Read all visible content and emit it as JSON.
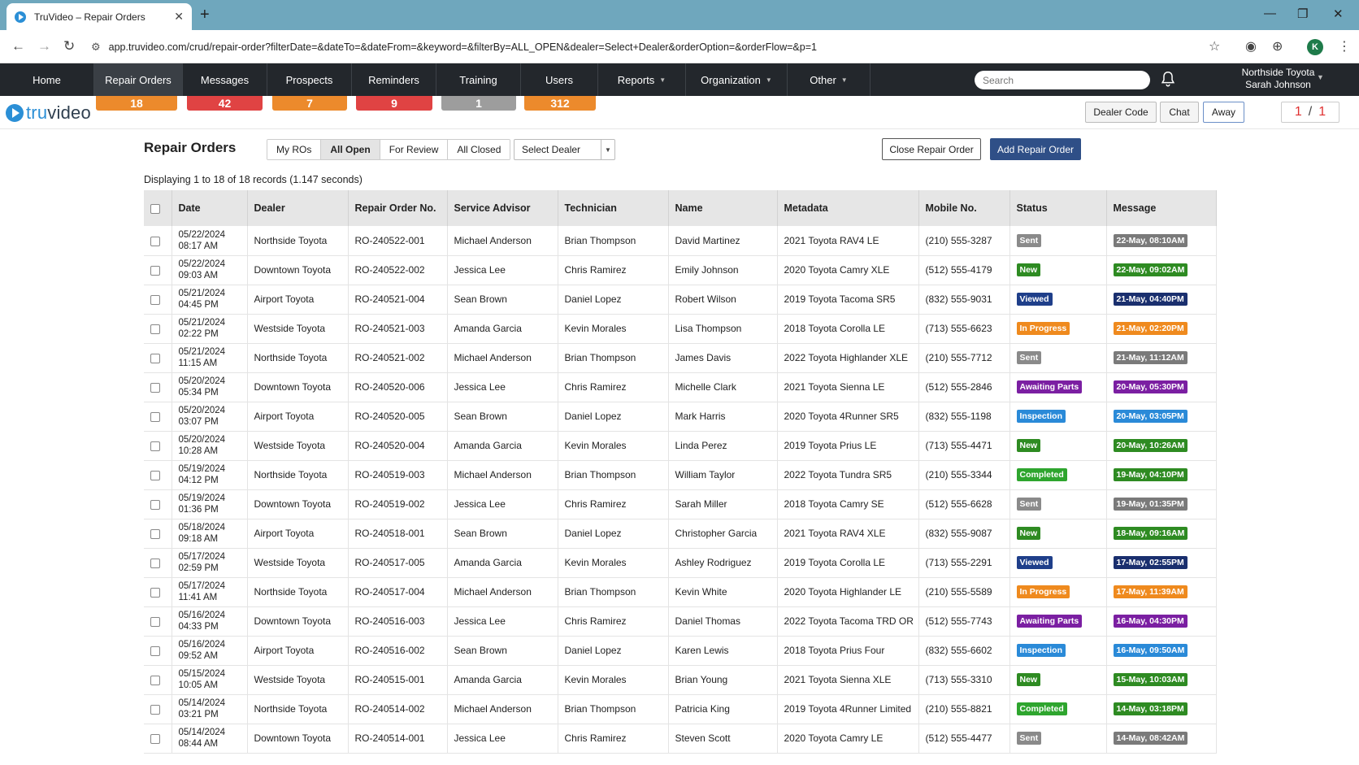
{
  "browser": {
    "tab_title": "TruVideo – Repair Orders",
    "url": "app.truvideo.com/crud/repair-order?filterDate=&dateTo=&dateFrom=&keyword=&filterBy=ALL_OPEN&dealer=Select+Dealer&orderOption=&orderFlow=&p=1",
    "profile_initial": "K"
  },
  "nav": {
    "items": [
      {
        "label": "Home",
        "caret": ""
      },
      {
        "label": "Repair Orders",
        "caret": ""
      },
      {
        "label": "Messages",
        "caret": ""
      },
      {
        "label": "Prospects",
        "caret": ""
      },
      {
        "label": "Reminders",
        "caret": ""
      },
      {
        "label": "Training",
        "caret": ""
      },
      {
        "label": "Users",
        "caret": ""
      },
      {
        "label": "Reports",
        "caret": "▼"
      },
      {
        "label": "Organization",
        "caret": "▼"
      },
      {
        "label": "Other",
        "caret": "▼"
      }
    ],
    "search_placeholder": "Search",
    "user_org": "Northside Toyota",
    "user_name": "Sarah Johnson"
  },
  "badges": [
    {
      "value": "18",
      "color": "#ec8a2c"
    },
    {
      "value": "42",
      "color": "#e04343"
    },
    {
      "value": "7",
      "color": "#ec8a2c"
    },
    {
      "value": "9",
      "color": "#e04343"
    },
    {
      "value": "1",
      "color": "#9d9d9d"
    },
    {
      "value": "312",
      "color": "#ec8a2c"
    }
  ],
  "logo": {
    "prefix": "tru",
    "suffix": "video"
  },
  "top_buttons": {
    "dealer_code": "Dealer Code",
    "chat": "Chat",
    "away": "Away"
  },
  "pager": {
    "current": "1",
    "sep": "/",
    "total": "1"
  },
  "toolbar": {
    "title": "Repair Orders",
    "filters": [
      "My ROs",
      "All Open",
      "For Review",
      "All Closed"
    ],
    "active_filter": "All Open",
    "dealer_select": "Select Dealer",
    "close_button": "Close Repair Order",
    "add_button": "Add Repair Order"
  },
  "records_text": "Displaying 1 to 18 of 18 records (1.147 seconds)",
  "table": {
    "columns": [
      "Date",
      "Dealer",
      "Repair Order No.",
      "Service Advisor",
      "Technician",
      "Name",
      "Metadata",
      "Mobile No.",
      "Status",
      "Message"
    ],
    "rows": [
      {
        "date": "05/22/2024",
        "time": "08:17 AM",
        "dealer": "Northside Toyota",
        "ro": "RO-240522-001",
        "advisor": "Michael Anderson",
        "tech": "Brian Thompson",
        "name": "David Martinez",
        "meta": "2021 Toyota RAV4 LE",
        "mobile": "(210) 555-3287",
        "status": "Sent",
        "message": "22-May, 08:10AM"
      },
      {
        "date": "05/22/2024",
        "time": "09:03 AM",
        "dealer": "Downtown Toyota",
        "ro": "RO-240522-002",
        "advisor": "Jessica Lee",
        "tech": "Chris Ramirez",
        "name": "Emily Johnson",
        "meta": "2020 Toyota Camry XLE",
        "mobile": "(512) 555-4179",
        "status": "New",
        "message": "22-May, 09:02AM"
      },
      {
        "date": "05/21/2024",
        "time": "04:45 PM",
        "dealer": "Airport Toyota",
        "ro": "RO-240521-004",
        "advisor": "Sean Brown",
        "tech": "Daniel Lopez",
        "name": "Robert Wilson",
        "meta": "2019 Toyota Tacoma SR5",
        "mobile": "(832) 555-9031",
        "status": "Viewed",
        "message": "21-May, 04:40PM"
      },
      {
        "date": "05/21/2024",
        "time": "02:22 PM",
        "dealer": "Westside Toyota",
        "ro": "RO-240521-003",
        "advisor": "Amanda Garcia",
        "tech": "Kevin Morales",
        "name": "Lisa Thompson",
        "meta": "2018 Toyota Corolla LE",
        "mobile": "(713) 555-6623",
        "status": "In Progress",
        "message": "21-May, 02:20PM"
      },
      {
        "date": "05/21/2024",
        "time": "11:15 AM",
        "dealer": "Northside Toyota",
        "ro": "RO-240521-002",
        "advisor": "Michael Anderson",
        "tech": "Brian Thompson",
        "name": "James Davis",
        "meta": "2022 Toyota Highlander XLE",
        "mobile": "(210) 555-7712",
        "status": "Sent",
        "message": "21-May, 11:12AM"
      },
      {
        "date": "05/20/2024",
        "time": "05:34 PM",
        "dealer": "Downtown Toyota",
        "ro": "RO-240520-006",
        "advisor": "Jessica Lee",
        "tech": "Chris Ramirez",
        "name": "Michelle Clark",
        "meta": "2021 Toyota Sienna LE",
        "mobile": "(512) 555-2846",
        "status": "Awaiting Parts",
        "message": "20-May, 05:30PM"
      },
      {
        "date": "05/20/2024",
        "time": "03:07 PM",
        "dealer": "Airport Toyota",
        "ro": "RO-240520-005",
        "advisor": "Sean Brown",
        "tech": "Daniel Lopez",
        "name": "Mark Harris",
        "meta": "2020 Toyota 4Runner SR5",
        "mobile": "(832) 555-1198",
        "status": "Inspection",
        "message": "20-May, 03:05PM"
      },
      {
        "date": "05/20/2024",
        "time": "10:28 AM",
        "dealer": "Westside Toyota",
        "ro": "RO-240520-004",
        "advisor": "Amanda Garcia",
        "tech": "Kevin Morales",
        "name": "Linda Perez",
        "meta": "2019 Toyota Prius LE",
        "mobile": "(713) 555-4471",
        "status": "New",
        "message": "20-May, 10:26AM"
      },
      {
        "date": "05/19/2024",
        "time": "04:12 PM",
        "dealer": "Northside Toyota",
        "ro": "RO-240519-003",
        "advisor": "Michael Anderson",
        "tech": "Brian Thompson",
        "name": "William Taylor",
        "meta": "2022 Toyota Tundra SR5",
        "mobile": "(210) 555-3344",
        "status": "Completed",
        "message": "19-May, 04:10PM"
      },
      {
        "date": "05/19/2024",
        "time": "01:36 PM",
        "dealer": "Downtown Toyota",
        "ro": "RO-240519-002",
        "advisor": "Jessica Lee",
        "tech": "Chris Ramirez",
        "name": "Sarah Miller",
        "meta": "2018 Toyota Camry SE",
        "mobile": "(512) 555-6628",
        "status": "Sent",
        "message": "19-May, 01:35PM"
      },
      {
        "date": "05/18/2024",
        "time": "09:18 AM",
        "dealer": "Airport Toyota",
        "ro": "RO-240518-001",
        "advisor": "Sean Brown",
        "tech": "Daniel Lopez",
        "name": "Christopher Garcia",
        "meta": "2021 Toyota RAV4 XLE",
        "mobile": "(832) 555-9087",
        "status": "New",
        "message": "18-May, 09:16AM"
      },
      {
        "date": "05/17/2024",
        "time": "02:59 PM",
        "dealer": "Westside Toyota",
        "ro": "RO-240517-005",
        "advisor": "Amanda Garcia",
        "tech": "Kevin Morales",
        "name": "Ashley Rodriguez",
        "meta": "2019 Toyota Corolla LE",
        "mobile": "(713) 555-2291",
        "status": "Viewed",
        "message": "17-May, 02:55PM"
      },
      {
        "date": "05/17/2024",
        "time": "11:41 AM",
        "dealer": "Northside Toyota",
        "ro": "RO-240517-004",
        "advisor": "Michael Anderson",
        "tech": "Brian Thompson",
        "name": "Kevin White",
        "meta": "2020 Toyota Highlander LE",
        "mobile": "(210) 555-5589",
        "status": "In Progress",
        "message": "17-May, 11:39AM"
      },
      {
        "date": "05/16/2024",
        "time": "04:33 PM",
        "dealer": "Downtown Toyota",
        "ro": "RO-240516-003",
        "advisor": "Jessica Lee",
        "tech": "Chris Ramirez",
        "name": "Daniel Thomas",
        "meta": "2022 Toyota Tacoma TRD OR",
        "mobile": "(512) 555-7743",
        "status": "Awaiting Parts",
        "message": "16-May, 04:30PM"
      },
      {
        "date": "05/16/2024",
        "time": "09:52 AM",
        "dealer": "Airport Toyota",
        "ro": "RO-240516-002",
        "advisor": "Sean Brown",
        "tech": "Daniel Lopez",
        "name": "Karen Lewis",
        "meta": "2018 Toyota Prius Four",
        "mobile": "(832) 555-6602",
        "status": "Inspection",
        "message": "16-May, 09:50AM"
      },
      {
        "date": "05/15/2024",
        "time": "10:05 AM",
        "dealer": "Westside Toyota",
        "ro": "RO-240515-001",
        "advisor": "Amanda Garcia",
        "tech": "Kevin Morales",
        "name": "Brian Young",
        "meta": "2021 Toyota Sienna XLE",
        "mobile": "(713) 555-3310",
        "status": "New",
        "message": "15-May, 10:03AM"
      },
      {
        "date": "05/14/2024",
        "time": "03:21 PM",
        "dealer": "Northside Toyota",
        "ro": "RO-240514-002",
        "advisor": "Michael Anderson",
        "tech": "Brian Thompson",
        "name": "Patricia King",
        "meta": "2019 Toyota 4Runner Limited",
        "mobile": "(210) 555-8821",
        "status": "Completed",
        "message": "14-May, 03:18PM"
      },
      {
        "date": "05/14/2024",
        "time": "08:44 AM",
        "dealer": "Downtown Toyota",
        "ro": "RO-240514-001",
        "advisor": "Jessica Lee",
        "tech": "Chris Ramirez",
        "name": "Steven Scott",
        "meta": "2020 Toyota Camry LE",
        "mobile": "(512) 555-4477",
        "status": "Sent",
        "message": "14-May, 08:42AM"
      }
    ]
  },
  "status_colors": {
    "Sent": "#8a8a8a",
    "New": "#2e8b22",
    "Viewed": "#1f3f8a",
    "In Progress": "#ef8a1e",
    "Awaiting Parts": "#7b1fa2",
    "Inspection": "#2a8ad8",
    "Completed": "#2ea52e"
  },
  "message_colors": {
    "Sent": "#7a7a7a",
    "New": "#2e8b22",
    "Viewed": "#1a2f6e",
    "In Progress": "#ef8a1e",
    "Awaiting Parts": "#7b1fa2",
    "Inspection": "#2a8ad8",
    "Completed": "#2e8b22"
  }
}
